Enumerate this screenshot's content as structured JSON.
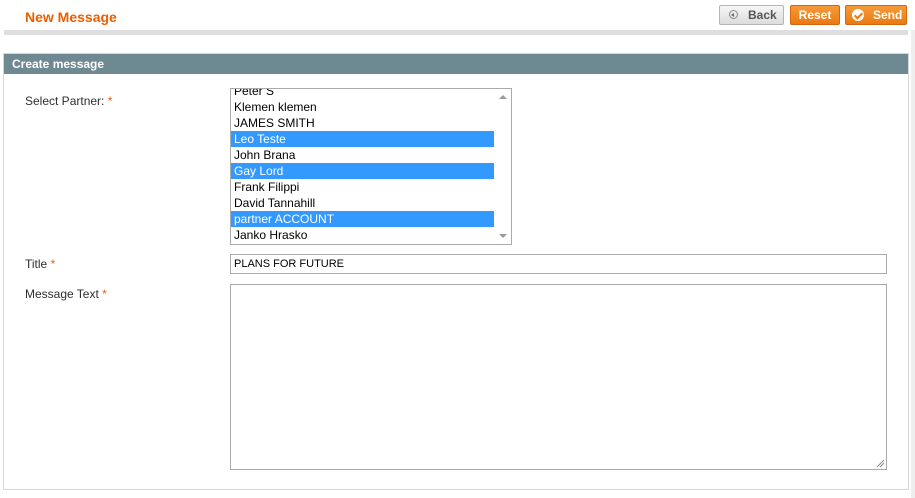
{
  "header": {
    "title": "New Message",
    "buttons": {
      "back": "Back",
      "reset": "Reset",
      "send": "Send"
    }
  },
  "form": {
    "legend": "Create message",
    "partner": {
      "label": "Select Partner:",
      "required_mark": "*",
      "options": [
        {
          "label": "Peter S",
          "selected": false
        },
        {
          "label": "Klemen klemen",
          "selected": false
        },
        {
          "label": "JAMES SMITH",
          "selected": false
        },
        {
          "label": "Leo Teste",
          "selected": true
        },
        {
          "label": "John Brana",
          "selected": false
        },
        {
          "label": "Gay Lord",
          "selected": true
        },
        {
          "label": "Frank Filippi",
          "selected": false
        },
        {
          "label": "David Tannahill",
          "selected": false
        },
        {
          "label": "partner ACCOUNT",
          "selected": true
        },
        {
          "label": "Janko Hrasko",
          "selected": false
        }
      ]
    },
    "title": {
      "label": "Title",
      "required_mark": "*",
      "value": "PLANS FOR FUTURE"
    },
    "message": {
      "label": "Message Text",
      "required_mark": "*",
      "value": ""
    }
  },
  "colors": {
    "title_orange": "#eb5e00",
    "button_orange": "#ea7a12",
    "legend_bg": "#6f8992",
    "selection_blue": "#3399ff"
  },
  "icons": {
    "back": "arrow-left-circle-icon",
    "send": "checkmark-circle-icon",
    "scroll_up": "triangle-up-icon",
    "scroll_down": "triangle-down-icon",
    "resize": "resize-grip-icon"
  }
}
